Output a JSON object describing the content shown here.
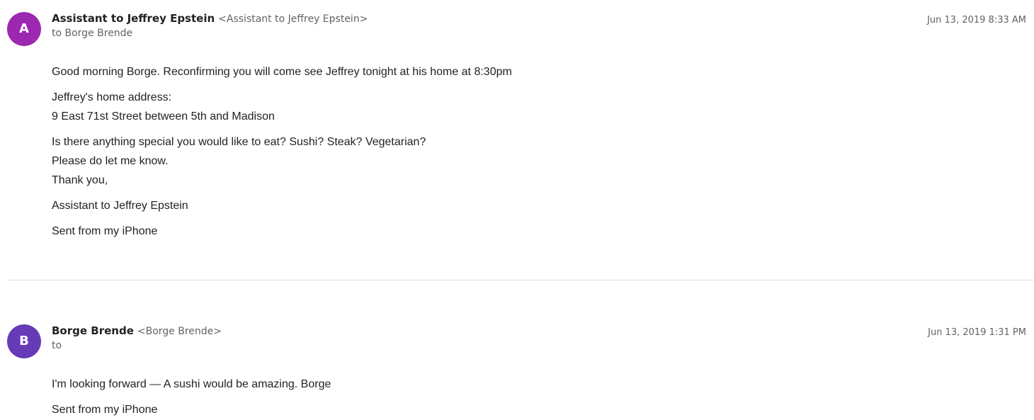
{
  "messages": [
    {
      "avatar_letter": "A",
      "avatar_color": "#9c27b0",
      "sender_name": "Assistant to Jeffrey Epstein",
      "sender_email": "<Assistant to Jeffrey Epstein>",
      "recipient": "to Borge Brende",
      "timestamp": "Jun 13, 2019 8:33 AM",
      "paragraphs": [
        [
          "Good morning Borge. Reconfirming you will come see Jeffrey tonight at his home at 8:30pm"
        ],
        [
          "Jeffrey's home address:",
          "9 East 71st Street between 5th and Madison"
        ],
        [
          "Is there anything special you would like to eat? Sushi? Steak? Vegetarian?",
          "Please do let me know.",
          "Thank you,"
        ],
        [
          "Assistant to Jeffrey Epstein"
        ],
        [
          "Sent from my iPhone"
        ]
      ]
    },
    {
      "avatar_letter": "B",
      "avatar_color": "#673ab7",
      "sender_name": "Borge Brende",
      "sender_email": "<Borge Brende>",
      "recipient": "to",
      "timestamp": "Jun 13, 2019 1:31 PM",
      "paragraphs": [
        [
          "I'm looking forward — A sushi would be amazing. Borge"
        ],
        [
          "Sent from my iPhone"
        ]
      ]
    }
  ]
}
